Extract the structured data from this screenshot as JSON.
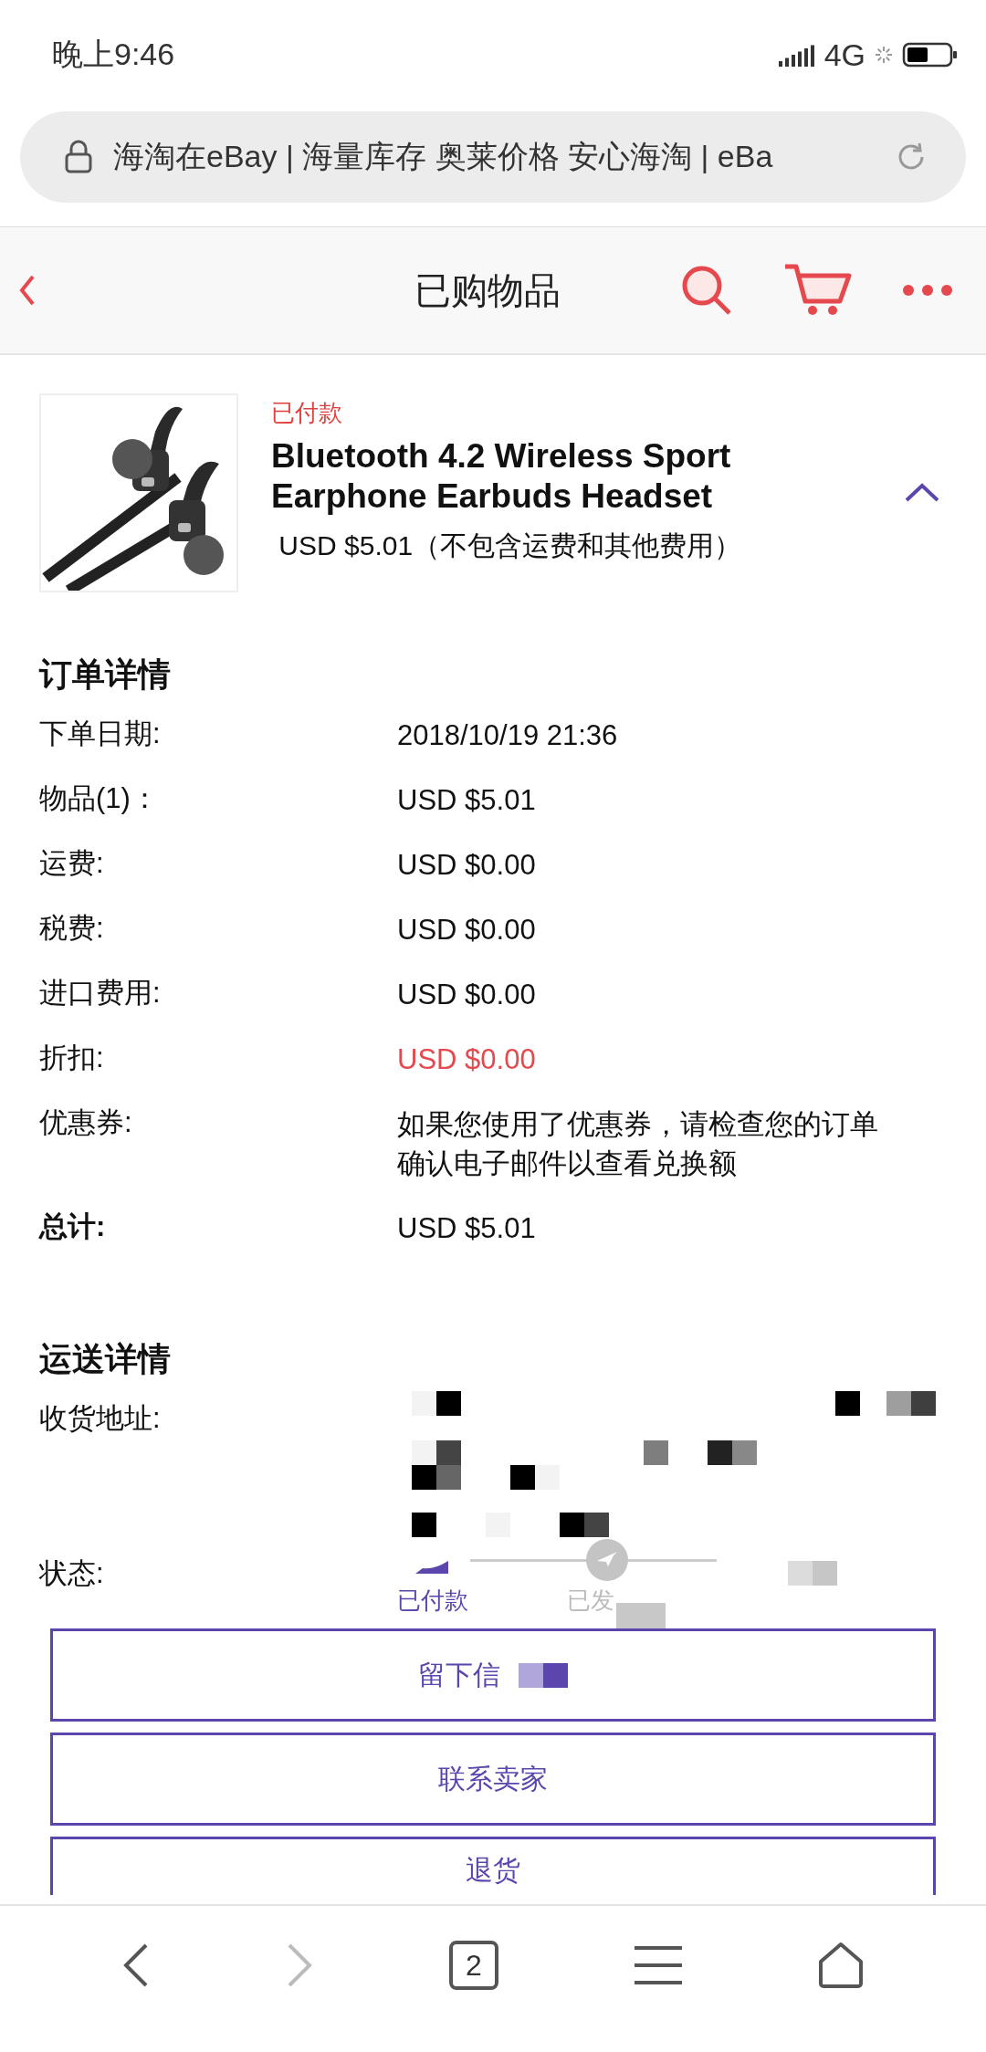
{
  "status_bar": {
    "time": "晚上9:46",
    "network": "4G"
  },
  "address_bar": {
    "url_text": "海淘在eBay | 海量库存 奥莱价格 安心海淘 | eBa"
  },
  "header": {
    "title": "已购物品"
  },
  "item": {
    "status": "已付款",
    "title": "Bluetooth 4.2 Wireless Sport Earphone Earbuds Headset",
    "price": " USD $5.01（不包含运费和其他费用）",
    "expanded": true
  },
  "order_details": {
    "heading": "订单详情",
    "rows": [
      {
        "label": "下单日期:",
        "value": "2018/10/19 21:36",
        "kind": "normal"
      },
      {
        "label": "物品(1)：",
        "value": "USD $5.01",
        "kind": "normal"
      },
      {
        "label": "运费:",
        "value": "USD $0.00",
        "kind": "normal"
      },
      {
        "label": "税费:",
        "value": "USD $0.00",
        "kind": "normal"
      },
      {
        "label": "进口费用:",
        "value": "USD $0.00",
        "kind": "normal"
      },
      {
        "label": "折扣:",
        "value": "USD $0.00",
        "kind": "discount"
      },
      {
        "label": "优惠券:",
        "value": "如果您使用了优惠券，请检查您的订单确认电子邮件以查看兑换额",
        "kind": "normal"
      },
      {
        "label": "总计:",
        "value": "USD $5.01",
        "kind": "total"
      }
    ]
  },
  "shipping_details": {
    "heading": "运送详情",
    "address_label": "收货地址:",
    "status_label": "状态:",
    "steps": [
      {
        "label": "已付款",
        "selected": true
      },
      {
        "label": "已发",
        "selected": false
      }
    ]
  },
  "buttons": [
    "留下信",
    "联系卖家",
    "退货"
  ],
  "bottom_nav": {
    "tab_count": "2"
  }
}
